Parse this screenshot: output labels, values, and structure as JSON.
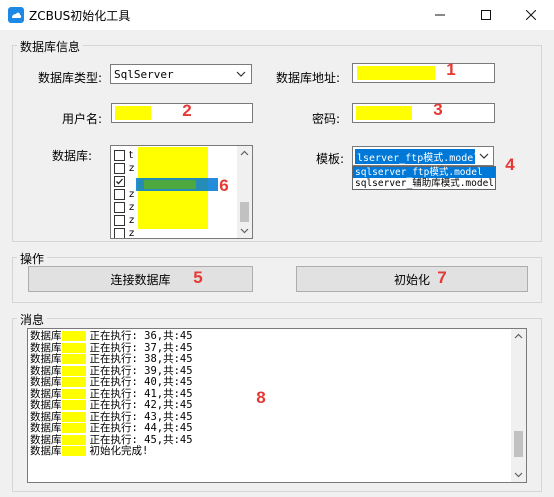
{
  "window": {
    "title": "ZCBUS初始化工具",
    "minimize_icon": "minimize-icon",
    "maximize_icon": "maximize-icon",
    "close_icon": "close-icon"
  },
  "db_group": {
    "title": "数据库信息",
    "db_type_label": "数据库类型:",
    "db_type_value": "SqlServer",
    "db_addr_label": "数据库地址:",
    "user_label": "用户名:",
    "password_label": "密码:",
    "database_label": "数据库:",
    "template_label": "模板:",
    "template_value": "lserver_ftp模式.model",
    "template_options": [
      "sqlserver_ftp模式.model",
      "sqlserver_辅助库模式.model"
    ],
    "db_list": [
      {
        "prefix": "t",
        "checked": false
      },
      {
        "prefix": "z",
        "checked": false
      },
      {
        "prefix": "",
        "checked": true
      },
      {
        "prefix": "z",
        "checked": false
      },
      {
        "prefix": "z",
        "checked": false
      },
      {
        "prefix": "z",
        "checked": false
      },
      {
        "prefix": "z",
        "checked": false
      }
    ]
  },
  "ops_group": {
    "title": "操作",
    "connect_label": "连接数据库",
    "init_label": "初始化"
  },
  "msg_group": {
    "title": "消息",
    "lines": [
      {
        "pre": "数据库",
        "post": "正在执行: 36,共:45"
      },
      {
        "pre": "数据库",
        "post": "正在执行: 37,共:45"
      },
      {
        "pre": "数据库",
        "post": "正在执行: 38,共:45"
      },
      {
        "pre": "数据库",
        "post": "正在执行: 39,共:45"
      },
      {
        "pre": "数据库",
        "post": "正在执行: 40,共:45"
      },
      {
        "pre": "数据库",
        "post": "正在执行: 41,共:45"
      },
      {
        "pre": "数据库",
        "post": "正在执行: 42,共:45"
      },
      {
        "pre": "数据库",
        "post": "正在执行: 43,共:45"
      },
      {
        "pre": "数据库",
        "post": "正在执行: 44,共:45"
      },
      {
        "pre": "数据库",
        "post": "正在执行: 45,共:45"
      },
      {
        "pre": "数据库",
        "post": "初始化完成!"
      }
    ]
  },
  "annotations": [
    "1",
    "2",
    "3",
    "4",
    "5",
    "6",
    "7",
    "8"
  ],
  "colors": {
    "highlight": "#ffff00",
    "annotation": "#e53935",
    "selection": "#0078d7"
  }
}
